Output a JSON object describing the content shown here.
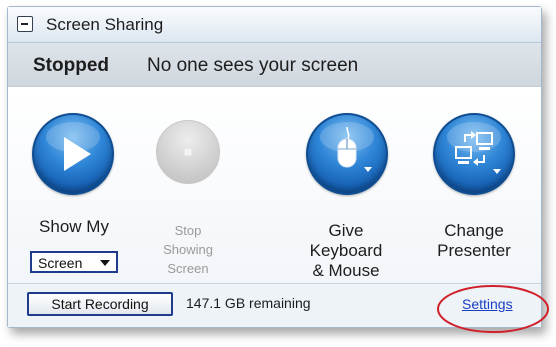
{
  "panel": {
    "title": "Screen Sharing"
  },
  "status": {
    "state": "Stopped",
    "message": "No one sees your screen"
  },
  "actions": {
    "show_my": {
      "label": "Show My",
      "select_value": "Screen",
      "icon": "play-icon",
      "enabled": true
    },
    "stop": {
      "label_line1": "Stop",
      "label_line2": "Showing",
      "label_line3": "Screen",
      "icon": "stop-icon",
      "enabled": false
    },
    "give_control": {
      "label_line1": "Give",
      "label_line2": "Keyboard",
      "label_line3": "& Mouse",
      "icon": "mouse-icon",
      "enabled": true
    },
    "change_presenter": {
      "label_line1": "Change",
      "label_line2": "Presenter",
      "icon": "swap-computers-icon",
      "enabled": true
    }
  },
  "footer": {
    "record_label": "Start Recording",
    "remaining": "147.1 GB remaining",
    "settings_label": "Settings"
  },
  "colors": {
    "accent_blue": "#2f86d7",
    "link": "#1a3fc2",
    "highlight_circle": "#d0202a"
  }
}
